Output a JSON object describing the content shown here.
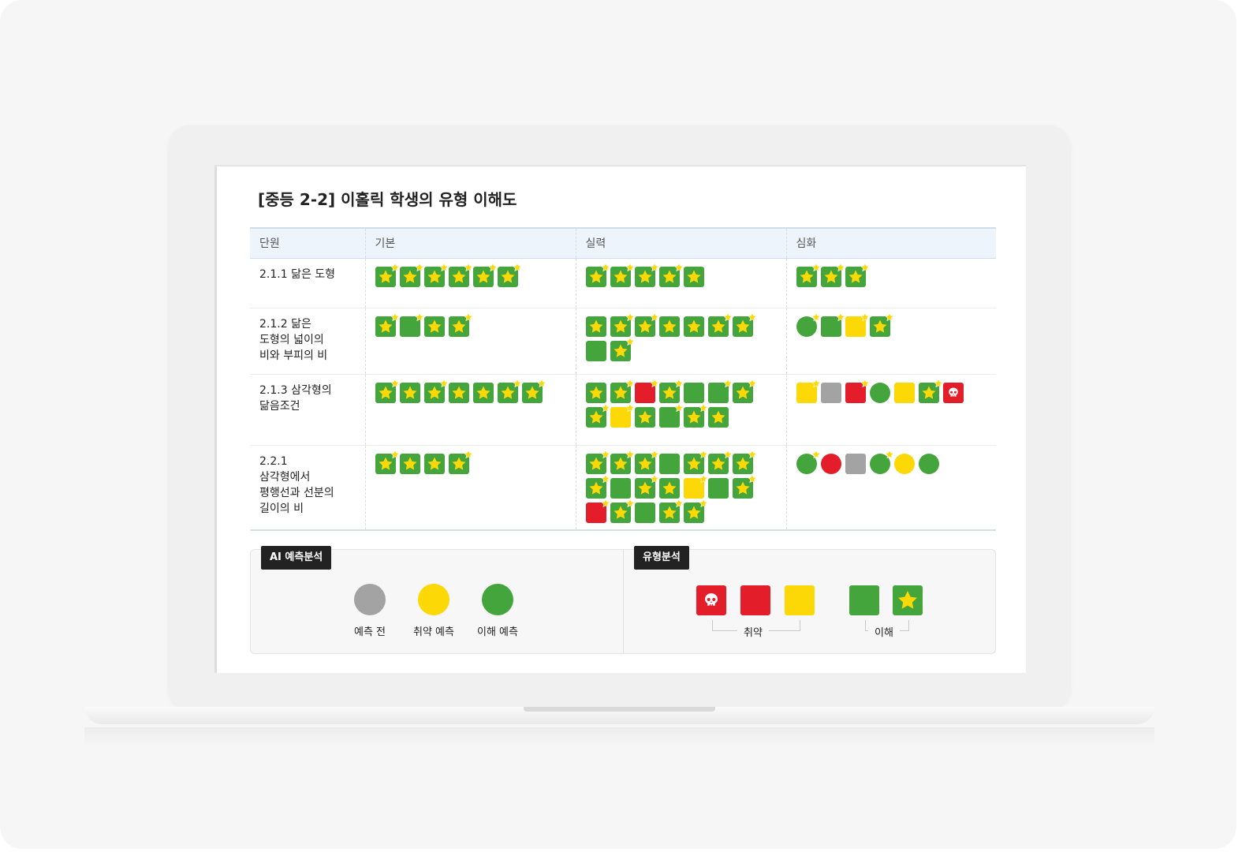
{
  "title": "[중등 2-2] 이홀릭 학생의 유형 이해도",
  "columns": [
    "단원",
    "기본",
    "실력",
    "심화"
  ],
  "rows": [
    {
      "unit": "2.1.1 닮은 도형",
      "basic": [
        "gsb",
        "gsb",
        "gsb",
        "gsb",
        "gsb",
        "gsb"
      ],
      "skill": [
        "gsb",
        "gsb",
        "gsb",
        "gsb",
        "gs"
      ],
      "advanced": [
        "gsb",
        "gsb",
        "gsb"
      ]
    },
    {
      "unit": "2.1.2 닮은\n도형의 넓이의\n비와 부피의 비",
      "basic": [
        "gsb",
        "gb",
        "gs",
        "gsb"
      ],
      "skill": [
        "gs",
        "gsb",
        "gsb",
        "gs",
        "gs",
        "gsb",
        "gsb",
        "g",
        "gsb"
      ],
      "advanced": [
        "gcb",
        "gb",
        "yb",
        "gsb"
      ]
    },
    {
      "unit": "2.1.3 삼각형의\n닮음조건",
      "basic": [
        "gsb",
        "gs",
        "gsb",
        "gs",
        "gs",
        "gsb",
        "gsb"
      ],
      "skill": [
        "gs",
        "gsb",
        "rb",
        "gsb",
        "g",
        "gb",
        "gsb",
        "gsb",
        "yb",
        "gs",
        "gb",
        "gsb",
        "gs"
      ],
      "advanced": [
        "yb",
        "a",
        "rb",
        "gc",
        "y",
        "gsb",
        "rx"
      ]
    },
    {
      "unit": "2.2.1\n삼각형에서\n평행선과 선분의\n길이의 비",
      "basic": [
        "gsb",
        "gs",
        "gs",
        "gsb"
      ],
      "skill": [
        "gsb",
        "gsb",
        "gsb",
        "g",
        "gsb",
        "gsb",
        "gsb",
        "gsb",
        "g",
        "gsb",
        "gs",
        "yb",
        "g",
        "gsb",
        "rb",
        "gsb",
        "g",
        "gsb",
        "gsb"
      ],
      "advanced": [
        "gcb",
        "rc",
        "a",
        "gcb",
        "yc",
        "gc"
      ]
    }
  ],
  "legend_ai": {
    "tag": "AI 예측분석",
    "items": [
      {
        "label": "예측 전",
        "color": "#a3a3a3"
      },
      {
        "label": "취약 예측",
        "color": "#fbd806"
      },
      {
        "label": "이해 예측",
        "color": "#44a53d"
      }
    ]
  },
  "legend_type": {
    "tag": "유형분석",
    "group_weak": "취약",
    "group_understand": "이해"
  },
  "colors": {
    "green": "#44a53d",
    "yellow": "#fbd806",
    "red": "#e31d2a",
    "gray": "#a3a3a3",
    "star": "#fbd806"
  }
}
